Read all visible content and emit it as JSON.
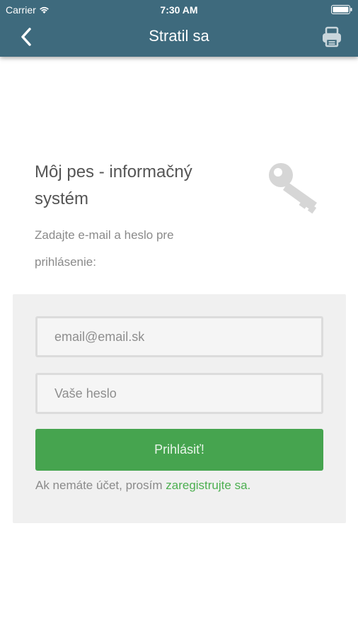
{
  "status_bar": {
    "carrier": "Carrier",
    "time": "7:30 AM",
    "icons": [
      "wifi-icon",
      "battery-icon"
    ]
  },
  "nav": {
    "title": "Stratil sa",
    "back_icon": "chevron-left-icon",
    "print_icon": "printer-icon"
  },
  "intro": {
    "title": "Môj pes - informačný systém",
    "subtitle": "Zadajte e-mail a heslo pre prihlásenie:",
    "icon": "key-icon"
  },
  "form": {
    "email_placeholder": "email@email.sk",
    "password_placeholder": "Vaše heslo",
    "login_label": "Prihlásiť!",
    "register_text": "Ak nemáte účet, prosím ",
    "register_link": "zaregistrujte sa."
  },
  "colors": {
    "header": "#3e6a7d",
    "button": "#46a44f",
    "link": "#4caf50",
    "panel": "#f0f0f0"
  }
}
